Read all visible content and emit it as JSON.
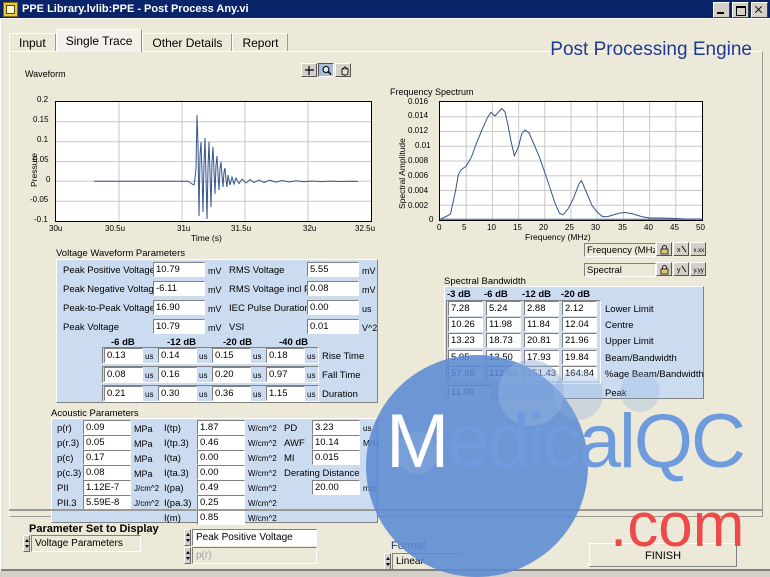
{
  "window": {
    "title": "PPE Library.lvlib:PPE - Post Process Any.vi",
    "icon": "labview-vi-icon",
    "buttons": {
      "minimize": "minimize-icon",
      "maximize": "maximize-icon",
      "close": "close-icon"
    }
  },
  "header": {
    "app_title": "Post Processing Engine"
  },
  "tabs": [
    {
      "label": "Input",
      "active": false
    },
    {
      "label": "Single Trace",
      "active": true
    },
    {
      "label": "Other Details",
      "active": false
    },
    {
      "label": "Report",
      "active": false
    }
  ],
  "waveform_chart": {
    "label": "Waveform",
    "tools": [
      "crosshair-cursor-icon",
      "zoom-magnifier-icon",
      "pan-hand-icon"
    ],
    "selected_tool": "zoom-magnifier-icon"
  },
  "spectrum_chart": {
    "label": "Frequency Spectrum"
  },
  "spectrum_controls": {
    "rows": [
      {
        "value": "Frequency  (MHz)",
        "tools": [
          "lock-icon",
          "xscale-icon",
          "xformat-icon"
        ]
      },
      {
        "value": "Spectral",
        "tools": [
          "lock-icon",
          "yscale-icon",
          "yformat-icon"
        ]
      }
    ]
  },
  "voltage_params": {
    "title": "Voltage Waveform Parameters",
    "left": [
      {
        "label": "Peak Positive Voltage",
        "value": "10.79",
        "unit": "mV"
      },
      {
        "label": "Peak Negative Voltage",
        "value": "-6.11",
        "unit": "mV"
      },
      {
        "label": "Peak-to-Peak Voltage",
        "value": "16.90",
        "unit": "mV"
      },
      {
        "label": "Peak Voltage",
        "value": "10.79",
        "unit": "mV"
      }
    ],
    "right": [
      {
        "label": "RMS Voltage",
        "value": "5.55",
        "unit": "mV"
      },
      {
        "label": "RMS Voltage incl PRF",
        "value": "0.08",
        "unit": "mV"
      },
      {
        "label": "IEC Pulse Duration",
        "value": "0.00",
        "unit": "us"
      },
      {
        "label": "VSI",
        "value": "0.01",
        "unit": "V^2"
      }
    ],
    "db_columns": [
      "-6 dB",
      "-12 dB",
      "-20 dB",
      "-40 dB"
    ],
    "db_rows": [
      {
        "name": "Rise Time",
        "values": [
          "0.13",
          "0.14",
          "0.15",
          "0.18"
        ],
        "unit": "us"
      },
      {
        "name": "Fall Time",
        "values": [
          "0.08",
          "0.16",
          "0.20",
          "0.97"
        ],
        "unit": "us"
      },
      {
        "name": "Duration",
        "values": [
          "0.21",
          "0.30",
          "0.36",
          "1.15"
        ],
        "unit": "us"
      }
    ]
  },
  "spectral_bandwidth": {
    "title": "Spectral Bandwidth",
    "columns": [
      "-3 dB",
      "-6 dB",
      "-12 dB",
      "-20 dB"
    ],
    "rows": [
      {
        "name": "Lower Limit",
        "values": [
          "7.28",
          "5.24",
          "2.88",
          "2.12"
        ]
      },
      {
        "name": "Centre",
        "values": [
          "10.26",
          "11.98",
          "11.84",
          "12.04"
        ]
      },
      {
        "name": "Upper Limit",
        "values": [
          "13.23",
          "18.73",
          "20.81",
          "21.96"
        ]
      },
      {
        "name": "Beam/Bandwidth",
        "values": [
          "5.95",
          "13.50",
          "17.93",
          "19.84"
        ]
      },
      {
        "name": "%age Beam/Bandwidth",
        "values": [
          "57.98",
          "112.64",
          "151.43",
          "164.84"
        ]
      }
    ],
    "peak": {
      "name": "Peak",
      "value": "11.99"
    }
  },
  "acoustic_params": {
    "title": "Acoustic Parameters",
    "col1": [
      {
        "label": "p(r)",
        "value": "0.09",
        "unit": "MPa"
      },
      {
        "label": "p(r.3)",
        "value": "0.05",
        "unit": "MPa"
      },
      {
        "label": "p(c)",
        "value": "0.17",
        "unit": "MPa"
      },
      {
        "label": "p(c.3)",
        "value": "0.08",
        "unit": "MPa"
      },
      {
        "label": "PII",
        "value": "1.12E-7",
        "unit": "J/cm^2"
      },
      {
        "label": "PII.3",
        "value": "5.59E-8",
        "unit": "J/cm^2"
      }
    ],
    "col2": [
      {
        "label": "I(tp)",
        "value": "1.87",
        "unit": "W/cm^2"
      },
      {
        "label": "I(tp.3)",
        "value": "0.46",
        "unit": "W/cm^2"
      },
      {
        "label": "I(ta)",
        "value": "0.00",
        "unit": "W/cm^2"
      },
      {
        "label": "I(ta.3)",
        "value": "0.00",
        "unit": "W/cm^2"
      },
      {
        "label": "I(pa)",
        "value": "0.49",
        "unit": "W/cm^2"
      },
      {
        "label": "I(pa.3)",
        "value": "0.25",
        "unit": "W/cm^2"
      },
      {
        "label": "I(m)",
        "value": "0.85",
        "unit": "W/cm^2"
      }
    ],
    "col3": [
      {
        "label": "PD",
        "value": "3.23",
        "unit": "us"
      },
      {
        "label": "AWF",
        "value": "10.14",
        "unit": "MHz"
      },
      {
        "label": "MI",
        "value": "0.015",
        "unit": ""
      },
      {
        "label": "Derating Distance",
        "value": "20.00",
        "unit": "mm"
      }
    ]
  },
  "footer": {
    "param_set_title": "Parameter Set to Display",
    "param_set_value": "Voltage Parameters",
    "selection_value": "Peak Positive Voltage",
    "selection_secondary": "p(r)",
    "format_title": "Format",
    "format_value": "Linear",
    "finish_label": "FINISH"
  },
  "watermark": {
    "text_left": "M",
    "text_rest": "edicalQC",
    "text_com": ".com",
    "circle_color": "#5b8ad4",
    "text_color": "#6e9ade",
    "com_color": "#ef4a4a"
  },
  "chart_data": [
    {
      "type": "line",
      "name": "waveform",
      "title": "Waveform",
      "xlabel": "Time (s)",
      "ylabel": "Pressure",
      "xticks": [
        "30u",
        "30.5u",
        "31u",
        "31.5u",
        "32u",
        "32.5u"
      ],
      "yticks": [
        "0.2",
        "0.15",
        "0.1",
        "0.05",
        "0",
        "-0.05",
        "-0.1"
      ],
      "xlim": [
        30.0,
        32.5
      ],
      "ylim": [
        -0.1,
        0.2
      ],
      "grid": true,
      "line_color": "#35558a",
      "x": [
        30.0,
        30.3,
        30.6,
        30.9,
        31.0,
        31.05,
        31.08,
        31.1,
        31.12,
        31.14,
        31.16,
        31.18,
        31.2,
        31.22,
        31.24,
        31.26,
        31.28,
        31.3,
        31.32,
        31.34,
        31.36,
        31.38,
        31.4,
        31.42,
        31.44,
        31.46,
        31.48,
        31.5,
        31.55,
        31.6,
        31.7,
        31.8,
        31.9,
        32.0,
        32.1,
        32.2,
        32.3,
        32.5
      ],
      "y": [
        0,
        0,
        0,
        0,
        0,
        0,
        -0.008,
        -0.032,
        0.03,
        0.166,
        -0.088,
        0.073,
        -0.094,
        0.166,
        -0.066,
        0.096,
        -0.04,
        0.047,
        -0.025,
        0.03,
        -0.018,
        0.02,
        -0.012,
        0.013,
        -0.009,
        0.009,
        -0.006,
        0.006,
        -0.004,
        0.004,
        -0.003,
        0.003,
        -0.002,
        0.002,
        -0.001,
        0.001,
        0.0,
        0.0
      ]
    },
    {
      "type": "line",
      "name": "frequency-spectrum",
      "title": "Frequency Spectrum",
      "xlabel": "Frequency  (MHz)",
      "ylabel": "Spectral Amplitude",
      "xticks": [
        "0",
        "5",
        "10",
        "15",
        "20",
        "25",
        "30",
        "35",
        "40",
        "45",
        "50"
      ],
      "yticks": [
        "0.016",
        "0.014",
        "0.012",
        "0.01",
        "0.008",
        "0.006",
        "0.004",
        "0.002",
        "0"
      ],
      "xlim": [
        0,
        50
      ],
      "ylim": [
        0,
        0.016
      ],
      "grid": true,
      "line_color": "#35558a",
      "x": [
        0,
        1,
        2,
        3,
        3.5,
        4,
        5,
        6,
        7,
        8,
        9,
        9.7,
        10.5,
        11,
        11.8,
        12.4,
        13,
        13.6,
        14.2,
        15,
        15.6,
        16.2,
        17,
        18,
        19,
        20,
        21,
        22,
        22.8,
        23.5,
        24.5,
        25.5,
        26.5,
        27,
        28,
        29,
        30,
        31,
        32,
        33,
        34.5,
        35.5,
        37,
        38.5,
        40,
        42,
        45,
        47,
        50
      ],
      "y": [
        0.0001,
        0.0003,
        0.0008,
        0.004,
        0.0061,
        0.0068,
        0.0073,
        0.0085,
        0.0105,
        0.0122,
        0.0138,
        0.0146,
        0.0141,
        0.0145,
        0.0151,
        0.0146,
        0.0128,
        0.0105,
        0.0087,
        0.01,
        0.0117,
        0.0122,
        0.0118,
        0.0102,
        0.0085,
        0.0065,
        0.0044,
        0.0022,
        0.0008,
        0.0006,
        0.0015,
        0.0029,
        0.0048,
        0.0053,
        0.0044,
        0.0028,
        0.0011,
        0.0004,
        0.0004,
        0.0006,
        0.0008,
        0.0009,
        0.0007,
        0.0004,
        0.0002,
        0.0002,
        0.0002,
        0.0001,
        0.0001
      ]
    }
  ]
}
